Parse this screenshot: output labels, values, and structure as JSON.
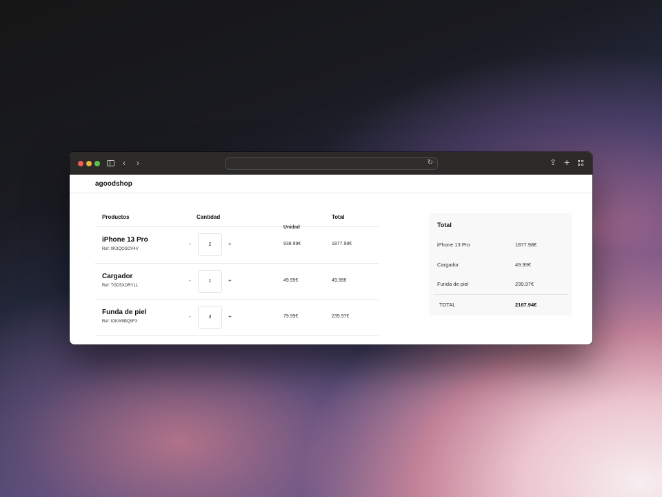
{
  "browser": {
    "address": "",
    "icons": [
      "sidebar-icon",
      "back-icon",
      "forward-icon",
      "reload-icon",
      "share-icon",
      "new-tab-icon",
      "tab-overview-icon"
    ]
  },
  "site": {
    "logo": "agoodshop"
  },
  "cart": {
    "headers": {
      "product": "Productos",
      "quantity": "Cantidad",
      "unit": "Unidad",
      "total": "Total"
    },
    "items": [
      {
        "name": "iPhone 13 Pro",
        "ref": "Ref: 0K3QOSOV4V",
        "qty": "2",
        "unit": "938.99€",
        "total": "1877.98€"
      },
      {
        "name": "Cargador",
        "ref": "Ref: TGD5XORY1L",
        "qty": "1",
        "unit": "49.99€",
        "total": "49.99€"
      },
      {
        "name": "Funda de piel",
        "ref": "Ref: IOKW9BQ9F3",
        "qty": "3",
        "unit": "79.99€",
        "total": "239.97€"
      }
    ],
    "minus_label": "-",
    "plus_label": "+"
  },
  "summary": {
    "title": "Total",
    "rows": [
      {
        "label": "iPhone 13 Pro",
        "value": "1877.98€"
      },
      {
        "label": "Cargador",
        "value": "49.99€"
      },
      {
        "label": "Funda de piel",
        "value": "239.97€"
      }
    ],
    "total_label": "TOTAL",
    "total_value": "2167.94€"
  }
}
